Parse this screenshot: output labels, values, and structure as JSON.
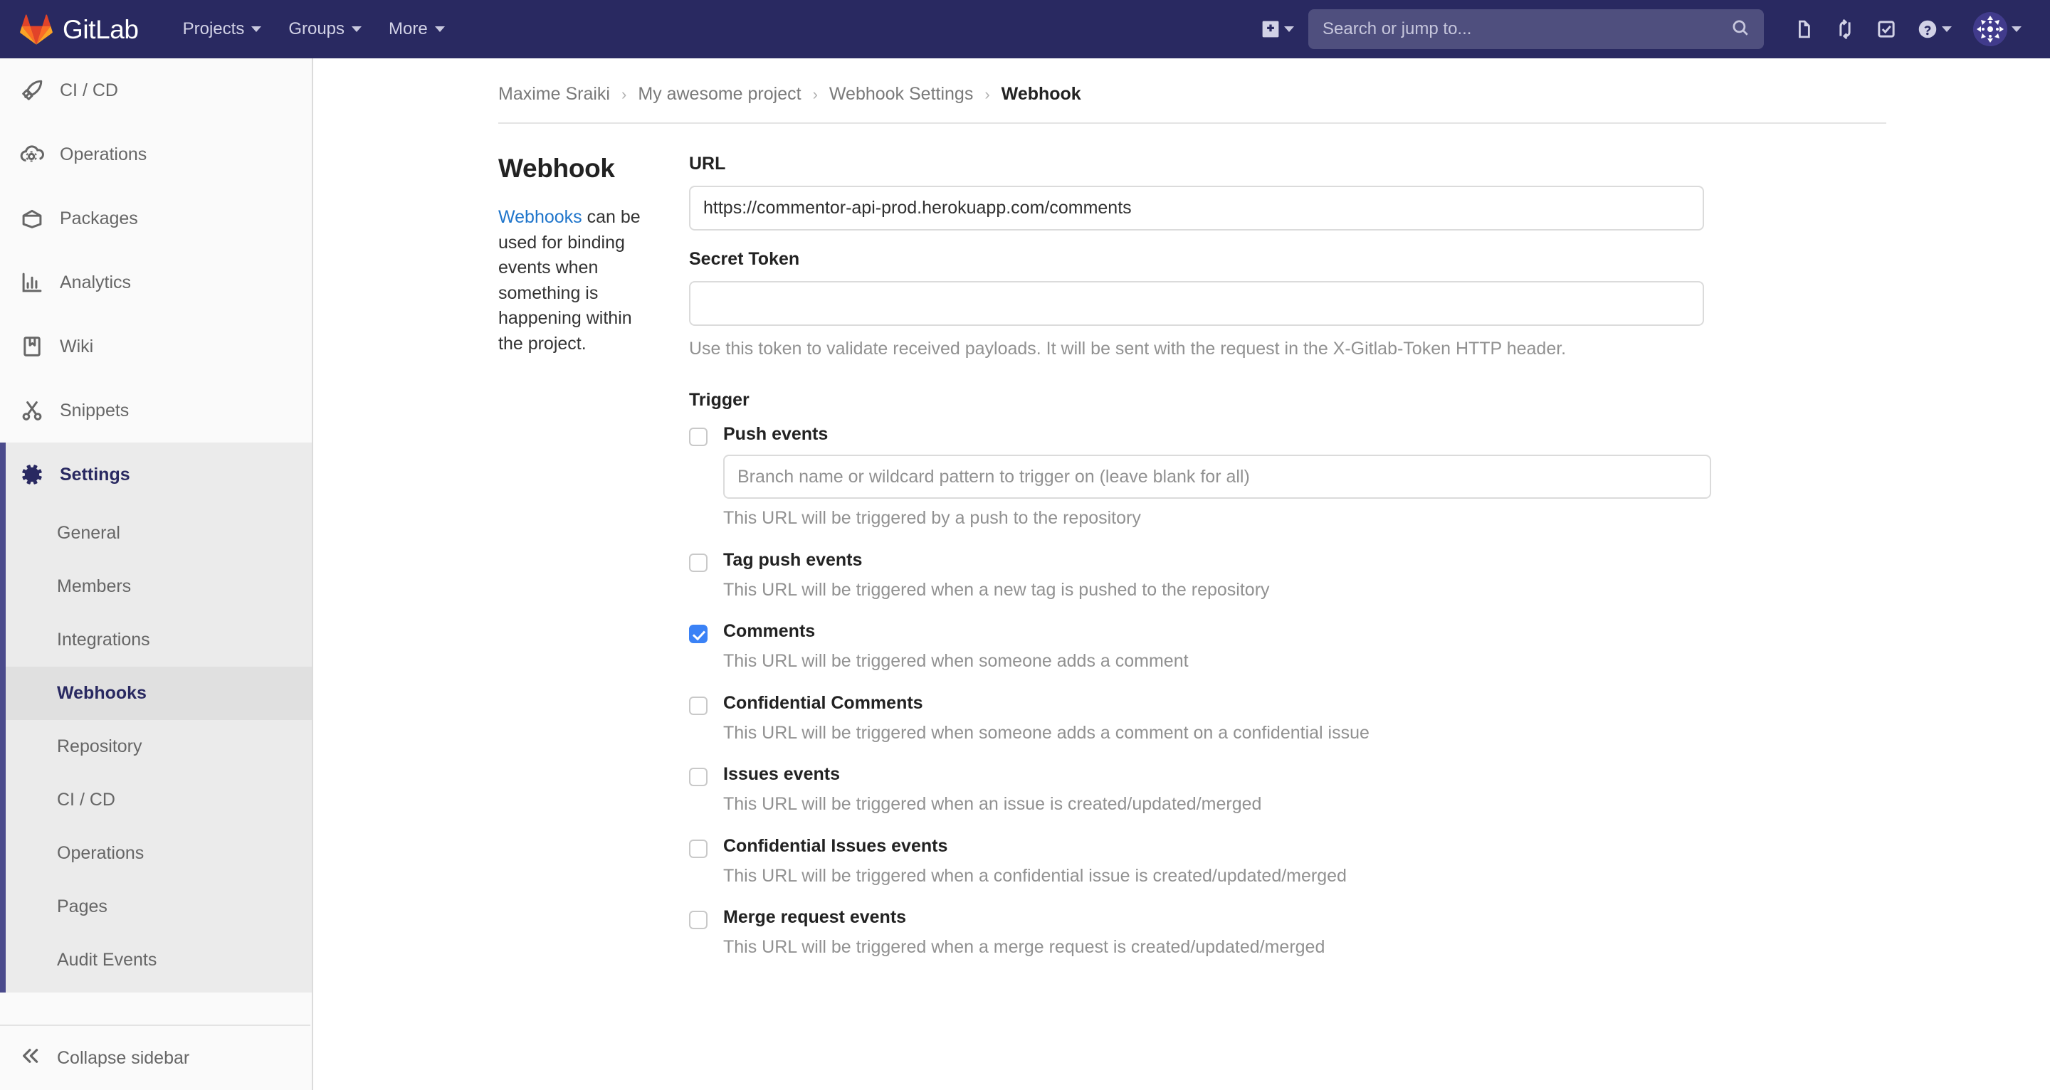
{
  "navbar": {
    "brand": "GitLab",
    "logo_icon": "gitlab-tanuki-logo",
    "menu": [
      {
        "label": "Projects",
        "icon": "chevron-down-icon"
      },
      {
        "label": "Groups",
        "icon": "chevron-down-icon"
      },
      {
        "label": "More",
        "icon": "chevron-down-icon"
      }
    ],
    "new_button": {
      "icon": "plus-square-icon",
      "caret": "chevron-down-icon"
    },
    "search": {
      "placeholder": "Search or jump to...",
      "value": "",
      "icon": "search-icon"
    },
    "icons": [
      {
        "name": "issues-icon"
      },
      {
        "name": "merge-requests-icon"
      },
      {
        "name": "todos-icon"
      }
    ],
    "help": {
      "icon": "help-circle-icon",
      "caret": "chevron-down-icon"
    },
    "avatar": {
      "icon": "user-avatar-identicon",
      "caret": "chevron-down-icon"
    }
  },
  "sidebar": {
    "items": [
      {
        "label": "CI / CD",
        "icon": "rocket-icon",
        "active": false
      },
      {
        "label": "Operations",
        "icon": "cloud-gear-icon",
        "active": false
      },
      {
        "label": "Packages",
        "icon": "package-icon",
        "active": false
      },
      {
        "label": "Analytics",
        "icon": "chart-bar-icon",
        "active": false
      },
      {
        "label": "Wiki",
        "icon": "book-icon",
        "active": false
      },
      {
        "label": "Snippets",
        "icon": "scissors-icon",
        "active": false
      },
      {
        "label": "Settings",
        "icon": "gear-icon",
        "active": true
      }
    ],
    "subitems": [
      {
        "label": "General",
        "active": false
      },
      {
        "label": "Members",
        "active": false
      },
      {
        "label": "Integrations",
        "active": false
      },
      {
        "label": "Webhooks",
        "active": true
      },
      {
        "label": "Repository",
        "active": false
      },
      {
        "label": "CI / CD",
        "active": false
      },
      {
        "label": "Operations",
        "active": false
      },
      {
        "label": "Pages",
        "active": false
      },
      {
        "label": "Audit Events",
        "active": false
      }
    ],
    "collapse": {
      "label": "Collapse sidebar",
      "icon": "chevron-double-left-icon"
    }
  },
  "breadcrumb": {
    "items": [
      "Maxime Sraiki",
      "My awesome project",
      "Webhook Settings"
    ],
    "current": "Webhook",
    "separator": "›"
  },
  "panel": {
    "title": "Webhook",
    "desc_link": "Webhooks",
    "desc_rest": " can be used for binding events when something is happening within the project."
  },
  "form": {
    "url_label": "URL",
    "url_value": "https://commentor-api-prod.herokuapp.com/comments",
    "url_placeholder": "",
    "secret_label": "Secret Token",
    "secret_value": "",
    "secret_placeholder": "",
    "secret_help": "Use this token to validate received payloads. It will be sent with the request in the X-Gitlab-Token HTTP header.",
    "trigger_label": "Trigger",
    "triggers": [
      {
        "label": "Push events",
        "checked": false,
        "has_input": true,
        "input_placeholder": "Branch name or wildcard pattern to trigger on (leave blank for all)",
        "input_value": "",
        "description": "This URL will be triggered by a push to the repository"
      },
      {
        "label": "Tag push events",
        "checked": false,
        "has_input": false,
        "description": "This URL will be triggered when a new tag is pushed to the repository"
      },
      {
        "label": "Comments",
        "checked": true,
        "has_input": false,
        "description": "This URL will be triggered when someone adds a comment"
      },
      {
        "label": "Confidential Comments",
        "checked": false,
        "has_input": false,
        "description": "This URL will be triggered when someone adds a comment on a confidential issue"
      },
      {
        "label": "Issues events",
        "checked": false,
        "has_input": false,
        "description": "This URL will be triggered when an issue is created/updated/merged"
      },
      {
        "label": "Confidential Issues events",
        "checked": false,
        "has_input": false,
        "description": "This URL will be triggered when a confidential issue is created/updated/merged"
      },
      {
        "label": "Merge request events",
        "checked": false,
        "has_input": false,
        "description": "This URL will be triggered when a merge request is created/updated/merged"
      }
    ]
  },
  "colors": {
    "navbar_bg": "#292961",
    "accent_blue": "#1f75cb",
    "checkbox_checked": "#3b82f6",
    "active_nav": "#292961",
    "sidebar_bg": "#fafafa"
  }
}
